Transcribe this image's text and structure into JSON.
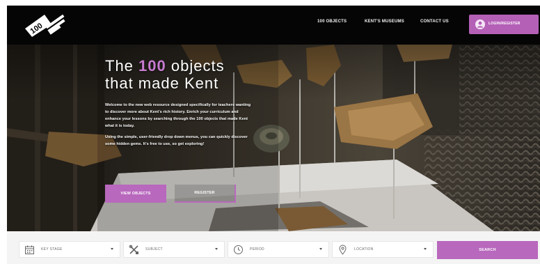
{
  "header": {
    "logo_icon": "100-objects-that-made-kent-logo",
    "nav": [
      {
        "label": "100 OBJECTS"
      },
      {
        "label": "KENT'S MUSEUMS"
      },
      {
        "label": "CONTACT US"
      }
    ],
    "login": {
      "label": "LOGIN/REGISTER",
      "icon": "user-icon"
    }
  },
  "hero": {
    "title_pre": "The ",
    "title_num": "100",
    "title_post": " objects",
    "title_line2": "that made Kent",
    "intro_p1": "Welcome to the new web resource designed specifically for teachers wanting to discover more about Kent's rich history. Enrich your curriculum and enhance your lessons by searching through the 100 objects that made Kent what it is today.",
    "intro_p2": "Using the simple, user-friendly drop down menus, you can quickly discover some hidden gems. It's free to use, so get exploring!",
    "view_button": "VIEW OBJECTS",
    "register_button": "REGISTER"
  },
  "search": {
    "filters": [
      {
        "label": "KEY STAGE",
        "icon": "calendar-icon"
      },
      {
        "label": "SUBJECT",
        "icon": "tools-icon"
      },
      {
        "label": "PERIOD",
        "icon": "clock-icon"
      },
      {
        "label": "LOCATION",
        "icon": "location-pin-icon"
      }
    ],
    "button": "SEARCH"
  },
  "colors": {
    "accent": "#b868bd",
    "header_bg": "#050505",
    "searchbar_bg": "#f4f4f4"
  }
}
